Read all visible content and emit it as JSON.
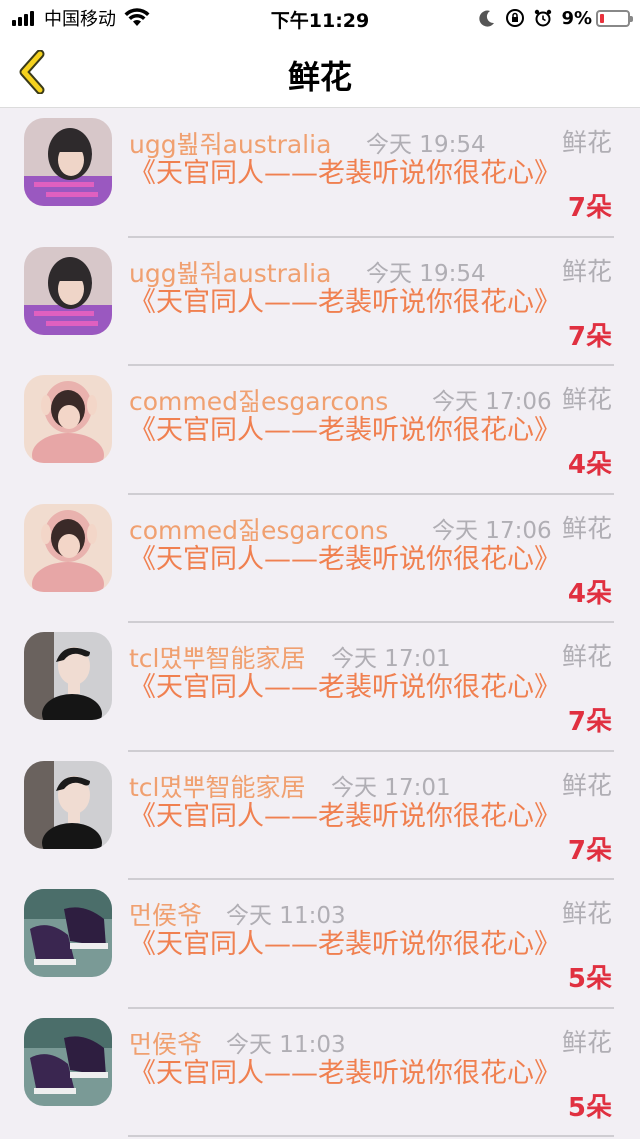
{
  "status_bar": {
    "carrier": "中国移动",
    "time": "下午11:29",
    "battery_pct": "9%"
  },
  "nav": {
    "title": "鲜花"
  },
  "colors": {
    "username": "#f0a070",
    "title_text": "#f08050",
    "count": "#e03040",
    "muted": "#b0aeb4"
  },
  "items": [
    {
      "user": "ugg뵖줘australia",
      "time": "今天 19:54",
      "type": "鲜花",
      "title": "《天官同人——老裴听说你很花心》",
      "count": "7朵",
      "avatar": "avatar-girl-purple"
    },
    {
      "user": "ugg뵖줘australia",
      "time": "今天 19:54",
      "type": "鲜花",
      "title": "《天官同人——老裴听说你很花心》",
      "count": "7朵",
      "avatar": "avatar-girl-purple"
    },
    {
      "user": "commed짊esgarcons",
      "time": "今天 17:06",
      "type": "鲜花",
      "title": "《天官同人——老裴听说你很花心》",
      "count": "4朵",
      "avatar": "avatar-pink-hood"
    },
    {
      "user": "commed짊esgarcons",
      "time": "今天 17:06",
      "type": "鲜花",
      "title": "《天官同人——老裴听说你很花心》",
      "count": "4朵",
      "avatar": "avatar-pink-hood"
    },
    {
      "user": "tcl몄뿌智能家居",
      "time": "今天 17:01",
      "type": "鲜花",
      "title": "《天官同人——老裴听说你很花心》",
      "count": "7朵",
      "avatar": "avatar-dark-boy"
    },
    {
      "user": "tcl몄뿌智能家居",
      "time": "今天 17:01",
      "type": "鲜花",
      "title": "《天官同人——老裴听说你很花心》",
      "count": "7朵",
      "avatar": "avatar-dark-boy"
    },
    {
      "user": "먼侯爷",
      "time": "今天 11:03",
      "type": "鲜花",
      "title": "《天官同人——老裴听说你很花心》",
      "count": "5朵",
      "avatar": "avatar-shoes"
    },
    {
      "user": "먼侯爷",
      "time": "今天 11:03",
      "type": "鲜花",
      "title": "《天官同人——老裴听说你很花心》",
      "count": "5朵",
      "avatar": "avatar-shoes"
    }
  ]
}
